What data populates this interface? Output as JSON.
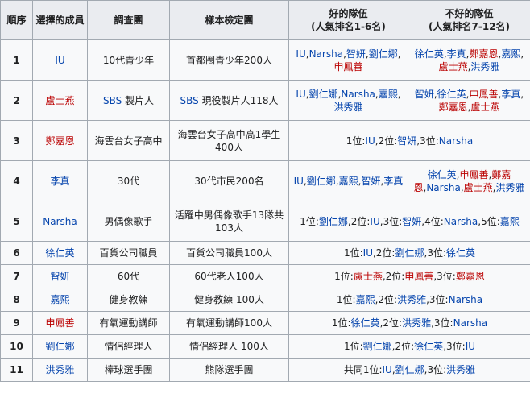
{
  "headers": {
    "order": "順序",
    "member": "選擇的成員",
    "survey": "調查團",
    "sample": "樣本檢定團",
    "good": "好的隊伍",
    "good_sub": "(人氣排名1-6名)",
    "bad": "不好的隊伍",
    "bad_sub": "(人氣排名7-12名)"
  },
  "rows": [
    {
      "no": "1",
      "member": [
        {
          "t": "IU",
          "c": "lnk"
        }
      ],
      "survey": [
        {
          "t": "10代青少年",
          "c": "plain"
        }
      ],
      "sample": [
        {
          "t": "首都圈青少年200人",
          "c": "plain"
        }
      ],
      "good": [
        {
          "t": "IU",
          "c": "lnk"
        },
        {
          "t": ",",
          "c": "plain"
        },
        {
          "t": "Narsha",
          "c": "lnk"
        },
        {
          "t": ",",
          "c": "plain"
        },
        {
          "t": "智妍",
          "c": "lnk"
        },
        {
          "t": ",",
          "c": "plain"
        },
        {
          "t": "劉仁娜",
          "c": "lnk"
        },
        {
          "t": ",",
          "c": "plain"
        },
        {
          "t": "申鳳善",
          "c": "red"
        }
      ],
      "bad": [
        {
          "t": "徐仁英",
          "c": "lnk"
        },
        {
          "t": ",",
          "c": "plain"
        },
        {
          "t": "李真",
          "c": "lnk"
        },
        {
          "t": ",",
          "c": "plain"
        },
        {
          "t": "鄭嘉恩",
          "c": "red"
        },
        {
          "t": ",",
          "c": "plain"
        },
        {
          "t": "嘉熙",
          "c": "lnk"
        },
        {
          "t": ",",
          "c": "plain"
        },
        {
          "t": "盧士燕",
          "c": "red"
        },
        {
          "t": ",",
          "c": "plain"
        },
        {
          "t": "洪秀雅",
          "c": "lnk"
        }
      ]
    },
    {
      "no": "2",
      "member": [
        {
          "t": "盧士燕",
          "c": "red"
        }
      ],
      "survey": [
        {
          "t": "SBS",
          "c": "lnk"
        },
        {
          "t": " 製片人",
          "c": "plain"
        }
      ],
      "sample": [
        {
          "t": "SBS",
          "c": "lnk"
        },
        {
          "t": " 現役製片人118人",
          "c": "plain"
        }
      ],
      "good": [
        {
          "t": "IU",
          "c": "lnk"
        },
        {
          "t": ",",
          "c": "plain"
        },
        {
          "t": "劉仁娜",
          "c": "lnk"
        },
        {
          "t": ",",
          "c": "plain"
        },
        {
          "t": "Narsha",
          "c": "lnk"
        },
        {
          "t": ",",
          "c": "plain"
        },
        {
          "t": "嘉熙",
          "c": "lnk"
        },
        {
          "t": ",",
          "c": "plain"
        },
        {
          "t": "洪秀雅",
          "c": "lnk"
        }
      ],
      "bad": [
        {
          "t": "智妍",
          "c": "lnk"
        },
        {
          "t": ",",
          "c": "plain"
        },
        {
          "t": "徐仁英",
          "c": "lnk"
        },
        {
          "t": ",",
          "c": "plain"
        },
        {
          "t": "申鳳善",
          "c": "red"
        },
        {
          "t": ",",
          "c": "plain"
        },
        {
          "t": "李真",
          "c": "lnk"
        },
        {
          "t": ",",
          "c": "plain"
        },
        {
          "t": "鄭嘉恩",
          "c": "red"
        },
        {
          "t": ",",
          "c": "plain"
        },
        {
          "t": "盧士燕",
          "c": "red"
        }
      ]
    },
    {
      "no": "3",
      "member": [
        {
          "t": "鄭嘉恩",
          "c": "red"
        }
      ],
      "survey": [
        {
          "t": "海雲台女子高中",
          "c": "plain"
        }
      ],
      "sample": [
        {
          "t": "海雲台女子高中高1學生400人",
          "c": "plain"
        }
      ],
      "combined": [
        {
          "t": "1位:",
          "c": "plain"
        },
        {
          "t": "IU",
          "c": "lnk"
        },
        {
          "t": ",2位:",
          "c": "plain"
        },
        {
          "t": "智妍",
          "c": "lnk"
        },
        {
          "t": ",3位:",
          "c": "plain"
        },
        {
          "t": "Narsha",
          "c": "lnk"
        }
      ]
    },
    {
      "no": "4",
      "member": [
        {
          "t": "李真",
          "c": "lnk"
        }
      ],
      "survey": [
        {
          "t": "30代",
          "c": "plain"
        }
      ],
      "sample": [
        {
          "t": "30代市民200名",
          "c": "plain"
        }
      ],
      "good": [
        {
          "t": "IU",
          "c": "lnk"
        },
        {
          "t": ",",
          "c": "plain"
        },
        {
          "t": "劉仁娜",
          "c": "lnk"
        },
        {
          "t": ",",
          "c": "plain"
        },
        {
          "t": "嘉熙",
          "c": "lnk"
        },
        {
          "t": ",",
          "c": "plain"
        },
        {
          "t": "智妍",
          "c": "lnk"
        },
        {
          "t": ",",
          "c": "plain"
        },
        {
          "t": "李真",
          "c": "lnk"
        }
      ],
      "bad": [
        {
          "t": "徐仁英",
          "c": "lnk"
        },
        {
          "t": ",",
          "c": "plain"
        },
        {
          "t": "申鳳善",
          "c": "red"
        },
        {
          "t": ",",
          "c": "plain"
        },
        {
          "t": "鄭嘉恩",
          "c": "red"
        },
        {
          "t": ",",
          "c": "plain"
        },
        {
          "t": "Narsha",
          "c": "lnk"
        },
        {
          "t": ",",
          "c": "plain"
        },
        {
          "t": "盧士燕",
          "c": "red"
        },
        {
          "t": ",",
          "c": "plain"
        },
        {
          "t": "洪秀雅",
          "c": "lnk"
        }
      ]
    },
    {
      "no": "5",
      "member": [
        {
          "t": "Narsha",
          "c": "lnk"
        }
      ],
      "survey": [
        {
          "t": "男偶像歌手",
          "c": "plain"
        }
      ],
      "sample": [
        {
          "t": "活躍中男偶像歌手13隊共103人",
          "c": "plain"
        }
      ],
      "combined": [
        {
          "t": "1位:",
          "c": "plain"
        },
        {
          "t": "劉仁娜",
          "c": "lnk"
        },
        {
          "t": ",2位:",
          "c": "plain"
        },
        {
          "t": "IU",
          "c": "lnk"
        },
        {
          "t": ",3位:",
          "c": "plain"
        },
        {
          "t": "智妍",
          "c": "lnk"
        },
        {
          "t": ",4位:",
          "c": "plain"
        },
        {
          "t": "Narsha",
          "c": "lnk"
        },
        {
          "t": ",5位:",
          "c": "plain"
        },
        {
          "t": "嘉熙",
          "c": "lnk"
        }
      ]
    },
    {
      "no": "6",
      "member": [
        {
          "t": "徐仁英",
          "c": "lnk"
        }
      ],
      "survey": [
        {
          "t": "百貨公司職員",
          "c": "plain"
        }
      ],
      "sample": [
        {
          "t": "百貨公司職員100人",
          "c": "plain"
        }
      ],
      "combined": [
        {
          "t": "1位:",
          "c": "plain"
        },
        {
          "t": "IU",
          "c": "lnk"
        },
        {
          "t": ",2位:",
          "c": "plain"
        },
        {
          "t": "劉仁娜",
          "c": "lnk"
        },
        {
          "t": ",3位:",
          "c": "plain"
        },
        {
          "t": "徐仁英",
          "c": "lnk"
        }
      ]
    },
    {
      "no": "7",
      "member": [
        {
          "t": "智妍",
          "c": "lnk"
        }
      ],
      "survey": [
        {
          "t": "60代",
          "c": "plain"
        }
      ],
      "sample": [
        {
          "t": "60代老人100人",
          "c": "plain"
        }
      ],
      "combined": [
        {
          "t": "1位:",
          "c": "plain"
        },
        {
          "t": "盧士燕",
          "c": "red"
        },
        {
          "t": ",2位:",
          "c": "plain"
        },
        {
          "t": "申鳳善",
          "c": "red"
        },
        {
          "t": ",3位:",
          "c": "plain"
        },
        {
          "t": "鄭嘉恩",
          "c": "red"
        }
      ]
    },
    {
      "no": "8",
      "member": [
        {
          "t": "嘉熙",
          "c": "lnk"
        }
      ],
      "survey": [
        {
          "t": "健身教練",
          "c": "plain"
        }
      ],
      "sample": [
        {
          "t": "健身教練 100人",
          "c": "plain"
        }
      ],
      "combined": [
        {
          "t": "1位:",
          "c": "plain"
        },
        {
          "t": "嘉熙",
          "c": "lnk"
        },
        {
          "t": ",2位:",
          "c": "plain"
        },
        {
          "t": "洪秀雅",
          "c": "lnk"
        },
        {
          "t": ",3位:",
          "c": "plain"
        },
        {
          "t": "Narsha",
          "c": "lnk"
        }
      ]
    },
    {
      "no": "9",
      "member": [
        {
          "t": "申鳳善",
          "c": "red"
        }
      ],
      "survey": [
        {
          "t": "有氧運動講師",
          "c": "plain"
        }
      ],
      "sample": [
        {
          "t": "有氧運動講師100人",
          "c": "plain"
        }
      ],
      "combined": [
        {
          "t": "1位:",
          "c": "plain"
        },
        {
          "t": "徐仁英",
          "c": "lnk"
        },
        {
          "t": ",2位:",
          "c": "plain"
        },
        {
          "t": "洪秀雅",
          "c": "lnk"
        },
        {
          "t": ",3位:",
          "c": "plain"
        },
        {
          "t": "Narsha",
          "c": "lnk"
        }
      ]
    },
    {
      "no": "10",
      "member": [
        {
          "t": "劉仁娜",
          "c": "lnk"
        }
      ],
      "survey": [
        {
          "t": "情侶經理人",
          "c": "plain"
        }
      ],
      "sample": [
        {
          "t": "情侶經理人 100人",
          "c": "plain"
        }
      ],
      "combined": [
        {
          "t": "1位:",
          "c": "plain"
        },
        {
          "t": "劉仁娜",
          "c": "lnk"
        },
        {
          "t": ",2位:",
          "c": "plain"
        },
        {
          "t": "徐仁英",
          "c": "lnk"
        },
        {
          "t": ",3位:",
          "c": "plain"
        },
        {
          "t": "IU",
          "c": "lnk"
        }
      ]
    },
    {
      "no": "11",
      "member": [
        {
          "t": "洪秀雅",
          "c": "lnk"
        }
      ],
      "survey": [
        {
          "t": "棒球選手團",
          "c": "plain"
        }
      ],
      "sample": [
        {
          "t": "熊隊選手團",
          "c": "plain"
        }
      ],
      "combined": [
        {
          "t": "共同1位:",
          "c": "plain"
        },
        {
          "t": "IU",
          "c": "lnk"
        },
        {
          "t": ",",
          "c": "plain"
        },
        {
          "t": "劉仁娜",
          "c": "lnk"
        },
        {
          "t": ",3位:",
          "c": "plain"
        },
        {
          "t": "洪秀雅",
          "c": "lnk"
        }
      ]
    }
  ]
}
